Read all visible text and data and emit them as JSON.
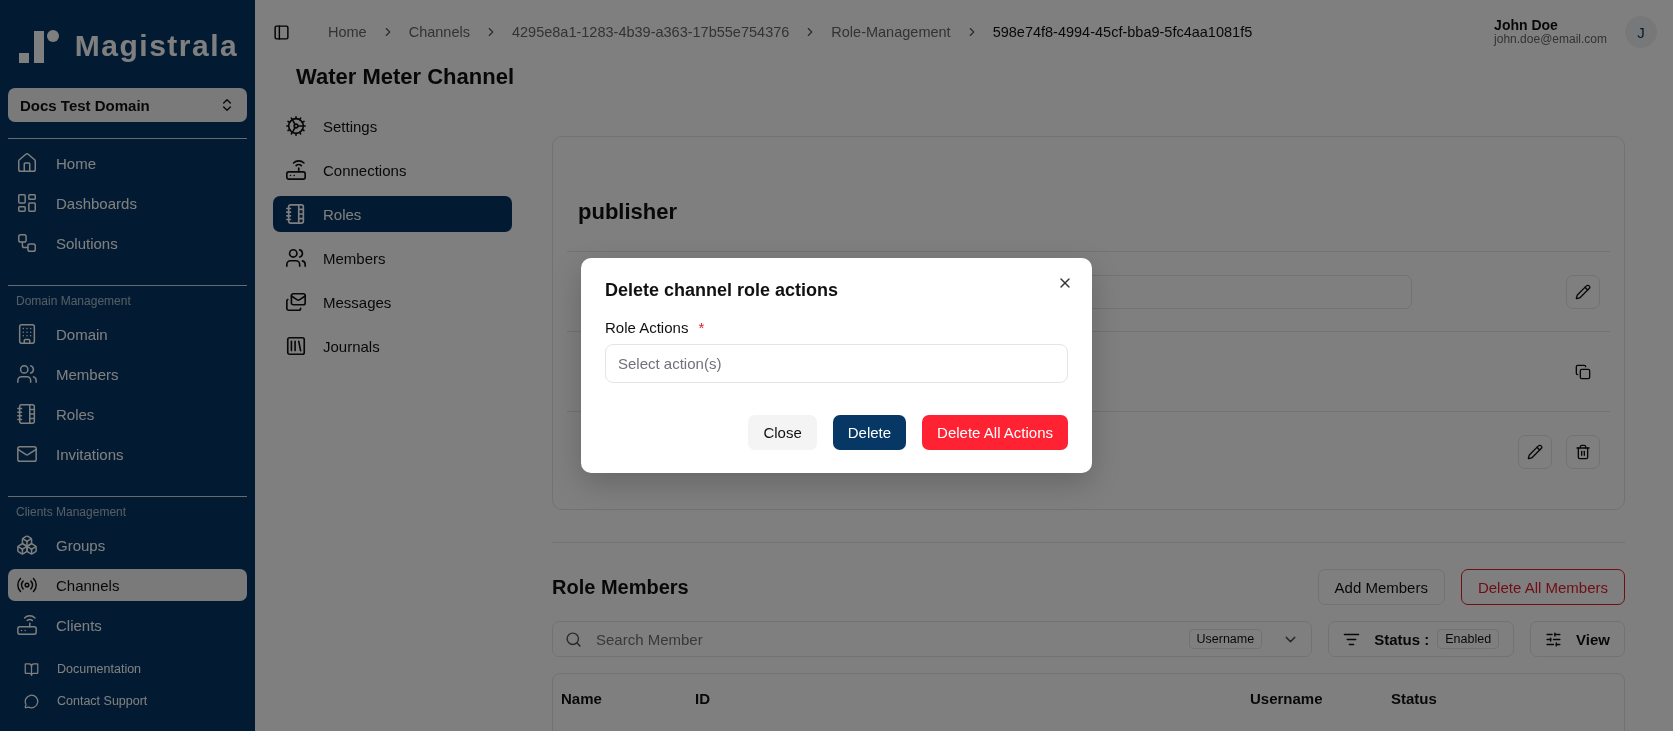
{
  "sidebar": {
    "logo": "Magistrala",
    "domain_select": {
      "value": "Docs Test Domain"
    },
    "sections": [
      {
        "items": [
          {
            "label": "Home",
            "selected": false
          },
          {
            "label": "Dashboards",
            "selected": false
          },
          {
            "label": "Solutions",
            "selected": false
          }
        ]
      },
      {
        "heading": "Domain Management",
        "items": [
          {
            "label": "Domain",
            "selected": false
          },
          {
            "label": "Members",
            "selected": false
          },
          {
            "label": "Roles",
            "selected": false
          },
          {
            "label": "Invitations",
            "selected": false
          }
        ]
      },
      {
        "heading": "Clients Management",
        "items": [
          {
            "label": "Groups",
            "selected": false
          },
          {
            "label": "Channels",
            "selected": true
          },
          {
            "label": "Clients",
            "selected": false
          }
        ]
      }
    ],
    "footer_links": [
      "Documentation",
      "Contact Support"
    ]
  },
  "header": {
    "breadcrumb": [
      "Home",
      "Channels",
      "4295e8a1-1283-4b39-a363-17b55e754376",
      "Role-Management",
      "598e74f8-4994-45cf-bba9-5fc4aa1081f5"
    ],
    "user": {
      "name": "John Doe",
      "email": "john.doe@email.com",
      "avatar": "J"
    }
  },
  "page": {
    "title": "Water Meter Channel",
    "nav": [
      {
        "label": "Settings",
        "selected": false
      },
      {
        "label": "Connections",
        "selected": false
      },
      {
        "label": "Roles",
        "selected": true
      },
      {
        "label": "Members",
        "selected": false
      },
      {
        "label": "Messages",
        "selected": false
      },
      {
        "label": "Journals",
        "selected": false
      }
    ],
    "role": {
      "name": "publisher",
      "rows": [
        {
          "kind": "field"
        },
        {
          "kind": "copyable"
        },
        {
          "kind": "editable"
        }
      ]
    },
    "role_members": {
      "title": "Role Members",
      "buttons": [
        {
          "label": "Add Members",
          "kind": "outline"
        },
        {
          "label": "Delete All Members",
          "kind": "danger-outline"
        }
      ],
      "search": {
        "placeholder": "Search Member",
        "filter": "Username"
      },
      "status_filter": {
        "label": "Status :",
        "value": "Enabled"
      },
      "view_button": "View",
      "table": {
        "columns": [
          "Name",
          "ID",
          "Username",
          "Status"
        ]
      }
    }
  },
  "dialog": {
    "title": "Delete channel role actions",
    "field": {
      "label": "Role Actions",
      "required_mark": "*",
      "placeholder": "Select action(s)"
    },
    "buttons": [
      {
        "label": "Close",
        "kind": "secondary"
      },
      {
        "label": "Delete",
        "kind": "primary"
      },
      {
        "label": "Delete All Actions",
        "kind": "danger"
      }
    ]
  }
}
